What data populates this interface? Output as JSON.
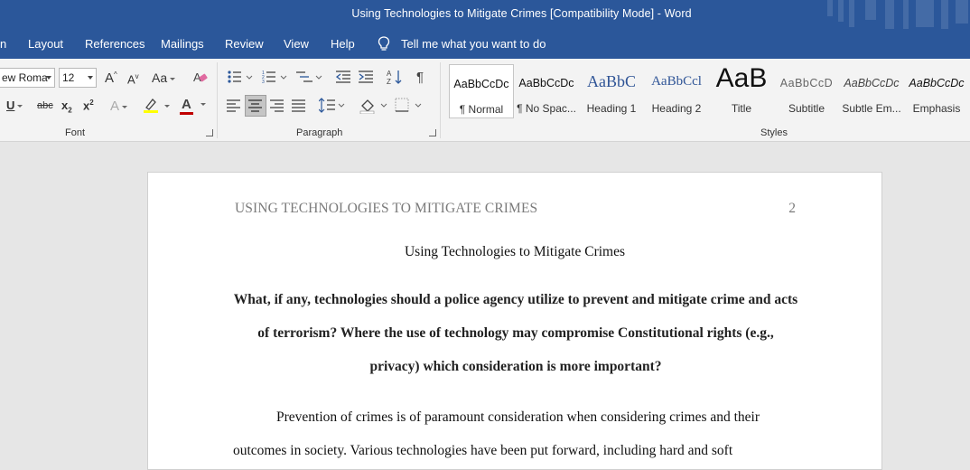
{
  "window": {
    "title": "Using Technologies to Mitigate Crimes [Compatibility Mode]  -  Word"
  },
  "menu": {
    "items": [
      "n",
      "Layout",
      "References",
      "Mailings",
      "Review",
      "View",
      "Help"
    ],
    "tell_me": "Tell me what you want to do"
  },
  "font_group": {
    "label": "Font",
    "font_name": "ew Roma",
    "font_size": "12",
    "grow": "A",
    "shrink": "A",
    "change_case": "Aa",
    "underline": "U",
    "strikethrough": "abc",
    "subscript": "x",
    "subscript_sub": "2",
    "superscript": "x",
    "superscript_sup": "2",
    "text_effects": "A",
    "font_color": "A",
    "font_color_hex": "#c00000",
    "highlight_hex": "#ffff00"
  },
  "paragraph_group": {
    "label": "Paragraph",
    "pilcrow": "¶"
  },
  "styles_group": {
    "label": "Styles",
    "items": [
      {
        "preview": "AaBbCcDc",
        "name": "¶ Normal"
      },
      {
        "preview": "AaBbCcDc",
        "name": "¶ No Spac..."
      },
      {
        "preview": "AaBbC",
        "name": "Heading 1"
      },
      {
        "preview": "AaBbCcl",
        "name": "Heading 2"
      },
      {
        "preview": "AaB",
        "name": "Title"
      },
      {
        "preview": "AaBbCcD",
        "name": "Subtitle"
      },
      {
        "preview": "AaBbCcDc",
        "name": "Subtle Em..."
      },
      {
        "preview": "AaBbCcDc",
        "name": "Emphasis"
      }
    ]
  },
  "document": {
    "running_header": "USING TECHNOLOGIES TO MITIGATE CRIMES",
    "page_number": "2",
    "title": "Using Technologies to Mitigate Crimes",
    "question": "What, if any, technologies should a police agency utilize to prevent and mitigate crime and acts of terrorism? Where the use of technology may compromise Constitutional rights (e.g., privacy) which consideration is more important?",
    "body": "Prevention of crimes is of paramount consideration when considering crimes and their outcomes in society. Various technologies have been put forward, including hard and soft"
  }
}
